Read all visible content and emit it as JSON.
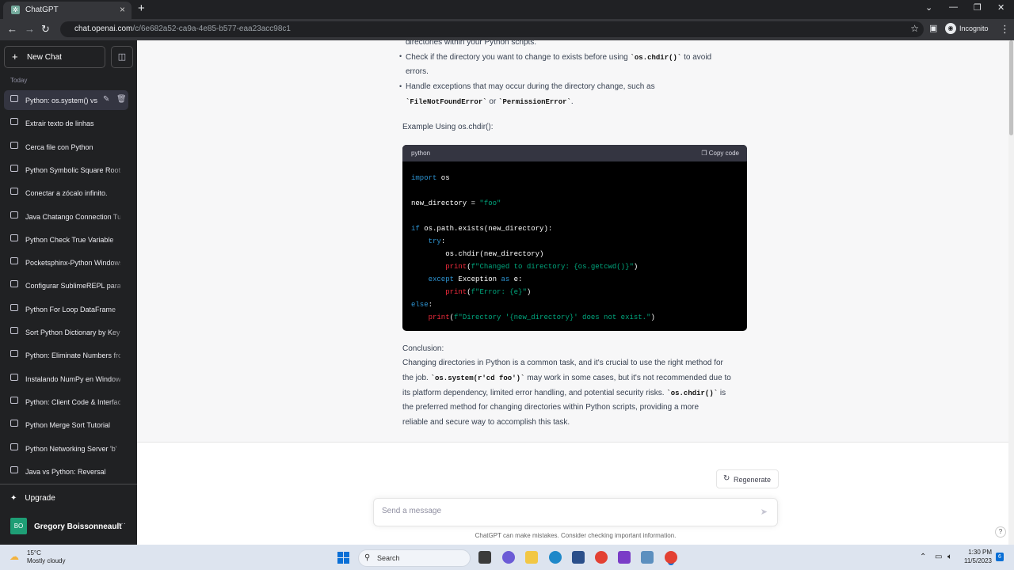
{
  "browser": {
    "tab_title": "ChatGPT",
    "url_host": "chat.openai.com",
    "url_path": "/c/6e682a52-ca9a-4e85-b577-eaa23acc98c1",
    "incognito_label": "Incognito"
  },
  "sidebar": {
    "new_chat": "New Chat",
    "section_today": "Today",
    "items": [
      {
        "label": "Python: os.system() vs"
      },
      {
        "label": "Extrair texto de linhas"
      },
      {
        "label": "Cerca file con Python"
      },
      {
        "label": "Python Symbolic Square Root"
      },
      {
        "label": "Conectar a zócalo infinito."
      },
      {
        "label": "Java Chatango Connection Tutorial"
      },
      {
        "label": "Python Check True Variable"
      },
      {
        "label": "Pocketsphinx-Python Windows"
      },
      {
        "label": "Configurar SublimeREPL para"
      },
      {
        "label": "Python For Loop DataFrame"
      },
      {
        "label": "Sort Python Dictionary by Key"
      },
      {
        "label": "Python: Eliminate Numbers from"
      },
      {
        "label": "Instalando NumPy en Windows"
      },
      {
        "label": "Python: Client Code & Interface"
      },
      {
        "label": "Python Merge Sort Tutorial"
      },
      {
        "label": "Python Networking Server 'b'"
      },
      {
        "label": "Java vs Python: Reversal"
      }
    ],
    "upgrade": "Upgrade",
    "user_initials": "BO",
    "user_name": "Gregory Boissonneault"
  },
  "message": {
    "line_top": "directories within your Python scripts.",
    "bullet2_a": "Check if the directory you want to change to exists before using",
    "bullet2_code": "`os.chdir()`",
    "bullet2_b": "to avoid",
    "bullet2_c": "errors.",
    "bullet3_a": "Handle exceptions that may occur during the directory change, such as",
    "bullet3_code1": "`FileNotFoundError`",
    "bullet3_or": "or",
    "bullet3_code2": "`PermissionError`",
    "bullet3_end": ".",
    "example_title": "Example Using os.chdir():",
    "code_lang": "python",
    "copy_code": "Copy code",
    "conclusion_title": "Conclusion:",
    "c1": "Changing directories in Python is a common task, and it's crucial to use the right method for",
    "c2a": "the job.",
    "c2code": "`os.system(r'cd foo')`",
    "c2b": "may work in some cases, but it's not recommended due to",
    "c3a": "its platform dependency, limited error handling, and potential security risks.",
    "c3code": "`os.chdir()`",
    "c3b": "is",
    "c4": "the preferred method for changing directories within Python scripts, providing a more",
    "c5": "reliable and secure way to accomplish this task."
  },
  "code": {
    "l1_kw": "import",
    "l1_rest": " os",
    "l3_var": "new_directory = ",
    "l3_str": "\"foo\"",
    "l5_kw": "if",
    "l5_rest": " os.path.exists(new_directory):",
    "l6_kw": "try",
    "l6_rest": ":",
    "l7": "os.chdir(new_directory)",
    "l8_fn": "print",
    "l8_p1": "(",
    "l8_str": "f\"Changed to directory: {os.getcwd()}\"",
    "l8_p2": ")",
    "l9_kw": "except",
    "l9_cls": " Exception ",
    "l9_kw2": "as",
    "l9_rest": " e:",
    "l10_fn": "print",
    "l10_p1": "(",
    "l10_str": "f\"Error: {e}\"",
    "l10_p2": ")",
    "l11_kw": "else",
    "l11_rest": ":",
    "l12_fn": "print",
    "l12_p1": "(",
    "l12_str": "f\"Directory '{new_directory}' does not exist.\"",
    "l12_p2": ")"
  },
  "composer": {
    "regenerate": "Regenerate",
    "placeholder": "Send a message",
    "disclaimer": "ChatGPT can make mistakes. Consider checking important information.",
    "help": "?"
  },
  "taskbar": {
    "temp": "15°C",
    "weather": "Mostly cloudy",
    "search": "Search",
    "time": "1:30 PM",
    "date": "11/5/2023",
    "notif_count": "6"
  }
}
